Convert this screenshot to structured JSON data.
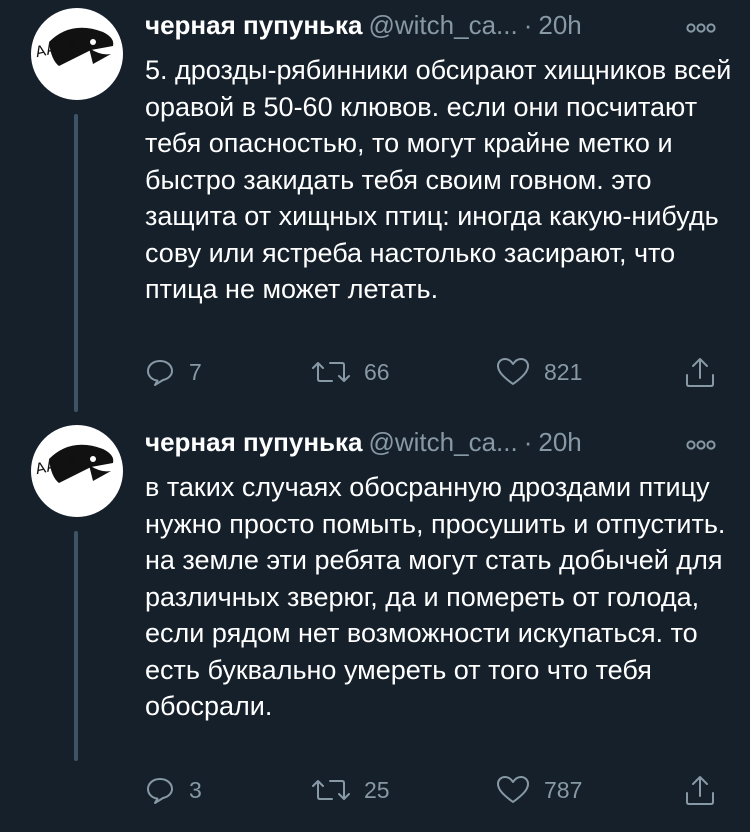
{
  "tweets": [
    {
      "name": "черная пупунька",
      "handle": "@witch_ca...",
      "dot": "·",
      "time": "20h",
      "avatar_text": "AAAA",
      "text": "5. дрозды-рябинники обсирают хищников всей оравой в 50-60 клювов. если они посчитают тебя опасностью, то могут крайне метко и быстро закидать тебя своим говном. это защита от хищных птиц: иногда какую-нибудь сову или ястреба настолько засирают, что птица не может летать.",
      "replies": "7",
      "retweets": "66",
      "likes": "821"
    },
    {
      "name": "черная пупунька",
      "handle": "@witch_ca...",
      "dot": "·",
      "time": "20h",
      "avatar_text": "AAAA",
      "text": "в таких случаях обосранную дроздами птицу нужно просто помыть, просушить и отпустить. на земле эти ребята могут стать добычей для различных зверюг, да и помереть от голода, если рядом нет возможности искупаться. то есть буквально умереть от того что тебя обосрали.",
      "replies": "3",
      "retweets": "25",
      "likes": "787"
    }
  ],
  "colors": {
    "background": "#15202b",
    "text": "#ffffff",
    "secondary": "#8899a6",
    "thread_line": "#3d5466"
  }
}
